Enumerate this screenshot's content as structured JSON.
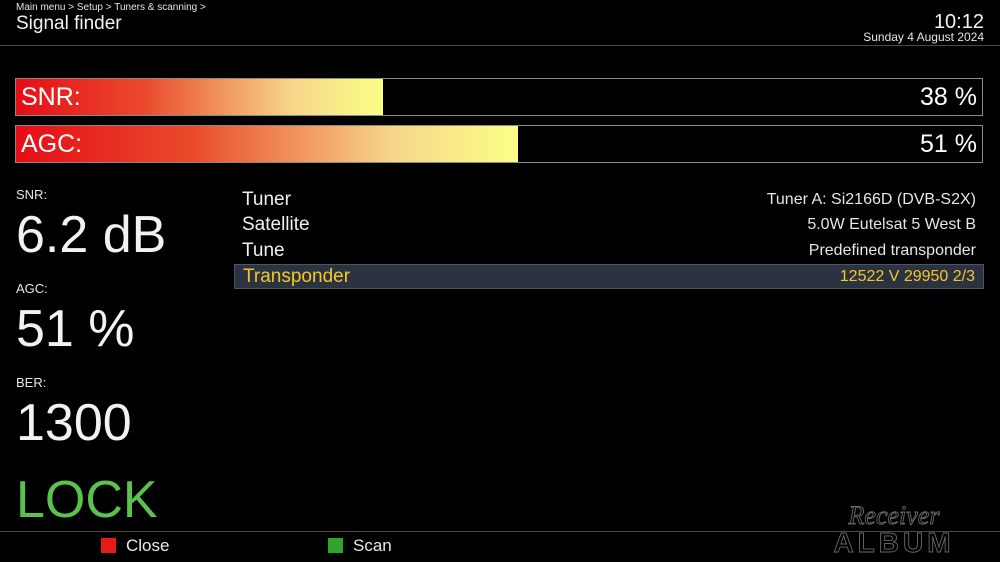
{
  "header": {
    "breadcrumb": "Main menu > Setup > Tuners & scanning >",
    "title": "Signal finder",
    "time": "10:12",
    "date": "Sunday  4 August 2024"
  },
  "bars": [
    {
      "label": "SNR:",
      "percent_text": "38 %",
      "level": 0.38
    },
    {
      "label": "AGC:",
      "percent_text": "51 %",
      "level": 0.52
    }
  ],
  "readouts": {
    "snr_label": "SNR:",
    "snr_value": "6.2 dB",
    "agc_label": "AGC:",
    "agc_value": "51 %",
    "ber_label": "BER:",
    "ber_value": "1300",
    "lock_status": "LOCK"
  },
  "info": [
    {
      "label": "Tuner",
      "value": "Tuner A: Si2166D (DVB-S2X)"
    },
    {
      "label": "Satellite",
      "value": "5.0W Eutelsat 5 West B"
    },
    {
      "label": "Tune",
      "value": "Predefined transponder"
    },
    {
      "label": "Transponder",
      "value": "12522 V 29950 2/3",
      "selected": true
    }
  ],
  "footer": {
    "red_key_label": "Close",
    "green_key_label": "Scan",
    "red_key_color": "#e41b17",
    "green_key_color": "#2fa52c"
  },
  "watermark": {
    "line1": "Receiver",
    "line2": "ALBUM"
  },
  "colors": {
    "lock": "#5bc24e",
    "selected_text": "#f6c52a",
    "selected_row_bg": "#2c3340"
  }
}
